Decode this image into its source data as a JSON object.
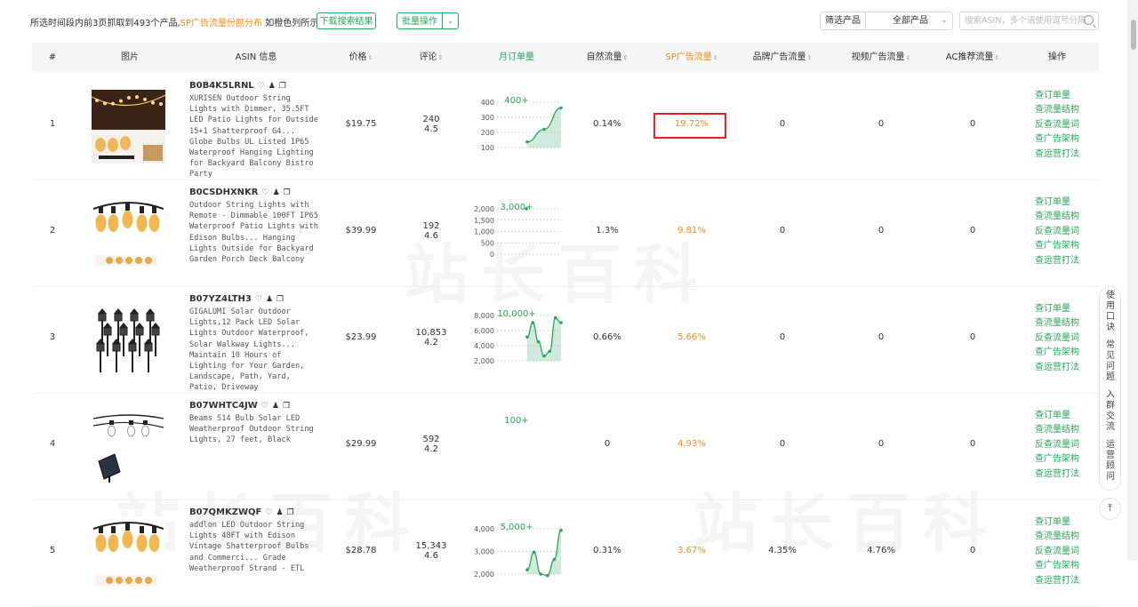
{
  "summary": {
    "prefix": "所选时间段内前3页抓取到493个产品,",
    "highlight": "SP广告流量份额分布",
    "suffix": " 如橙色列所示"
  },
  "toolbar": {
    "download_label": "下载搜索结果",
    "batch_label": "批量操作",
    "filter_label": "筛选产品",
    "filter_value": "全部产品",
    "search_placeholder": "搜索ASIN，多个请使用逗号分隔"
  },
  "columns": {
    "index": "#",
    "image": "图片",
    "asin": "ASIN 信息",
    "price": "价格",
    "reviews": "评论",
    "monthly": "月订单量",
    "organic": "自然流量",
    "sp": "SP广告流量",
    "brand": "品牌广告流量",
    "video": "视频广告流量",
    "ac": "AC推荐流量",
    "ops": "操作"
  },
  "row_actions": [
    "查订单量",
    "查流量结构",
    "反查流量词",
    "查广告架构",
    "查运营打法"
  ],
  "rows": [
    {
      "index": "1",
      "asin": "B0B4K5LRNL",
      "title": "XURISEN Outdoor String Lights with Dimmer, 35.5FT LED Patio Lights for Outside 15+1 Shatterproof G4... Globe Bulbs UL Listed IP65 Waterproof Hanging Lighting for Backyard Balcony Bistro Party",
      "price": "$19.75",
      "reviews": "240",
      "rating": "4.5",
      "monthly": "400+",
      "ticks": [
        "400",
        "300",
        "200",
        "100"
      ],
      "trend": [
        100,
        210,
        400
      ],
      "ymin": 50,
      "ymax": 450,
      "organic": "0.14%",
      "sp": "19.72%",
      "brand": "0",
      "video": "0",
      "ac": "0"
    },
    {
      "index": "2",
      "asin": "B0CSDHXNKR",
      "title": "Outdoor String Lights with Remote - Dimmable 100FT IP65 Waterproof Patio Lights with Edison Bulbs... Hanging Lights Outside for Backyard Garden Porch Deck Balcony",
      "price": "$39.99",
      "reviews": "192",
      "rating": "4.6",
      "monthly": "3,000+",
      "ticks": [
        "2,000",
        "1,500",
        "1,000",
        "500",
        "0"
      ],
      "trend": [
        2000
      ],
      "ymin": 0,
      "ymax": 2000,
      "organic": "1.3%",
      "sp": "9.81%",
      "brand": "0",
      "video": "0",
      "ac": "0"
    },
    {
      "index": "3",
      "asin": "B07YZ4LTH3",
      "title": "GIGALUMI Solar Outdoor Lights,12 Pack LED Solar Lights Outdoor Waterproof, Solar Walkway Lights... Maintain 10 Hours of Lighting for Your Garden, Landscape, Path, Yard, Patio, Driveway",
      "price": "$23.99",
      "reviews": "10,853",
      "rating": "4.2",
      "monthly": "10,000+",
      "ticks": [
        "8,000",
        "6,000",
        "4,000",
        "2,000"
      ],
      "trend": [
        5000,
        8000,
        4000,
        1000,
        2000,
        9000,
        8000
      ],
      "ymin": 0,
      "ymax": 9500,
      "organic": "0.66%",
      "sp": "5.66%",
      "brand": "0",
      "video": "0",
      "ac": "0"
    },
    {
      "index": "4",
      "asin": "B07WHTC4JW",
      "title": "Beams S14 Bulb Solar LED Weatherproof Outdoor String Lights, 27 feet, Black",
      "price": "$29.99",
      "reviews": "592",
      "rating": "4.2",
      "monthly": "100+",
      "ticks": [],
      "trend": [],
      "ymin": 0,
      "ymax": 1,
      "organic": "0",
      "sp": "4.93%",
      "brand": "0",
      "video": "0",
      "ac": "0"
    },
    {
      "index": "5",
      "asin": "B07QMKZWQF",
      "title": "addlon LED Outdoor String Lights 48FT with Edison Vintage Shatterproof Bulbs and Commerci... Grade Weatherproof Strand - ETL",
      "price": "$28.78",
      "reviews": "15,343",
      "rating": "4.6",
      "monthly": "5,000+",
      "ticks": [
        "4,000",
        "3,000",
        "2,000"
      ],
      "trend": [
        1800,
        3000,
        1500,
        1400,
        2500,
        4500
      ],
      "ymin": 1500,
      "ymax": 4600,
      "organic": "0.31%",
      "sp": "3.67%",
      "brand": "4.35%",
      "video": "4.76%",
      "ac": "0"
    }
  ],
  "side_panel": [
    "使用口诀",
    "常见问题",
    "入群交流",
    "运营顾问"
  ],
  "watermark": "站长百科",
  "colors": {
    "green": "#2aa55a",
    "orange": "#f08c1e",
    "red": "#e02424"
  }
}
